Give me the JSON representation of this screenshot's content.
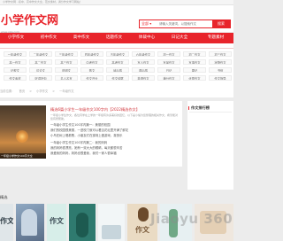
{
  "topbar": {
    "text": "小学作文网 · 初中、高中作文大全，范文素材，满分作文学习网站！"
  },
  "header": {
    "logo_text": "小学作文网",
    "logo_sub": "www.xzw.com",
    "search": {
      "category": "全部 ▾",
      "placeholder": "请输入关键词，以搜索作文",
      "button": "搜索"
    }
  },
  "nav": {
    "items": [
      "小学作文",
      "初中作文",
      "高中作文",
      "话题作文",
      "体裁中心",
      "日记大全",
      "专题素材"
    ]
  },
  "tags": [
    "一年级作文",
    "二年级作文",
    "三年级作文",
    "四年级作文",
    "五年级作文",
    "六年级作文",
    "初一作文",
    "初二作文",
    "初三作文",
    "高一作文",
    "高二作文",
    "高三作文",
    "中考作文",
    "高考作文",
    "写人作文",
    "写景作文",
    "写事作文",
    "状物作文",
    "记叙文",
    "议论文",
    "说明文",
    "散文",
    "读后感",
    "观后感",
    "日记",
    "周记",
    "书信",
    "作文素材",
    "好词好句",
    "名人名言",
    "作文开头",
    "作文结尾",
    "英语作文",
    "满分作文",
    "优秀作文",
    "作文指导"
  ],
  "breadcrumb": [
    "当前位置：",
    "首页",
    ">",
    "小学作文",
    ">",
    "一年级作文"
  ],
  "feature": {
    "caption": "一年级小学作文100字大全",
    "title": "精选6篇小学生一年级作文100字内【2022精选作文】",
    "meta": "一年级小学生作文，各位同学在上学的一年级有许多美好的回忆，以下是小编为您整理的相关作文，希望能对您有所帮助。",
    "lines": [
      "一年级小学生作文100字内篇一：美丽的校园",
      "我们的校园很美丽，一进校门就可以看见花坛里开满了鲜花",
      "小鸟在树上唱着歌，小朋友们在操场上做游戏，真快乐",
      "一年级小学生作文100字内篇二：我的妈妈",
      "我的妈妈很漂亮，她有一双大大的眼睛，每天都很辛苦",
      "我爱我的妈妈，妈妈也很爱我，我们一家人很幸福"
    ]
  },
  "sidebar": {
    "title": "作文排行榜"
  },
  "section": {
    "label": "精选"
  },
  "thumbs": [
    "作文",
    "",
    "作文",
    "",
    "",
    "作文",
    "",
    ""
  ],
  "watermark": "Jiaoyu 360"
}
